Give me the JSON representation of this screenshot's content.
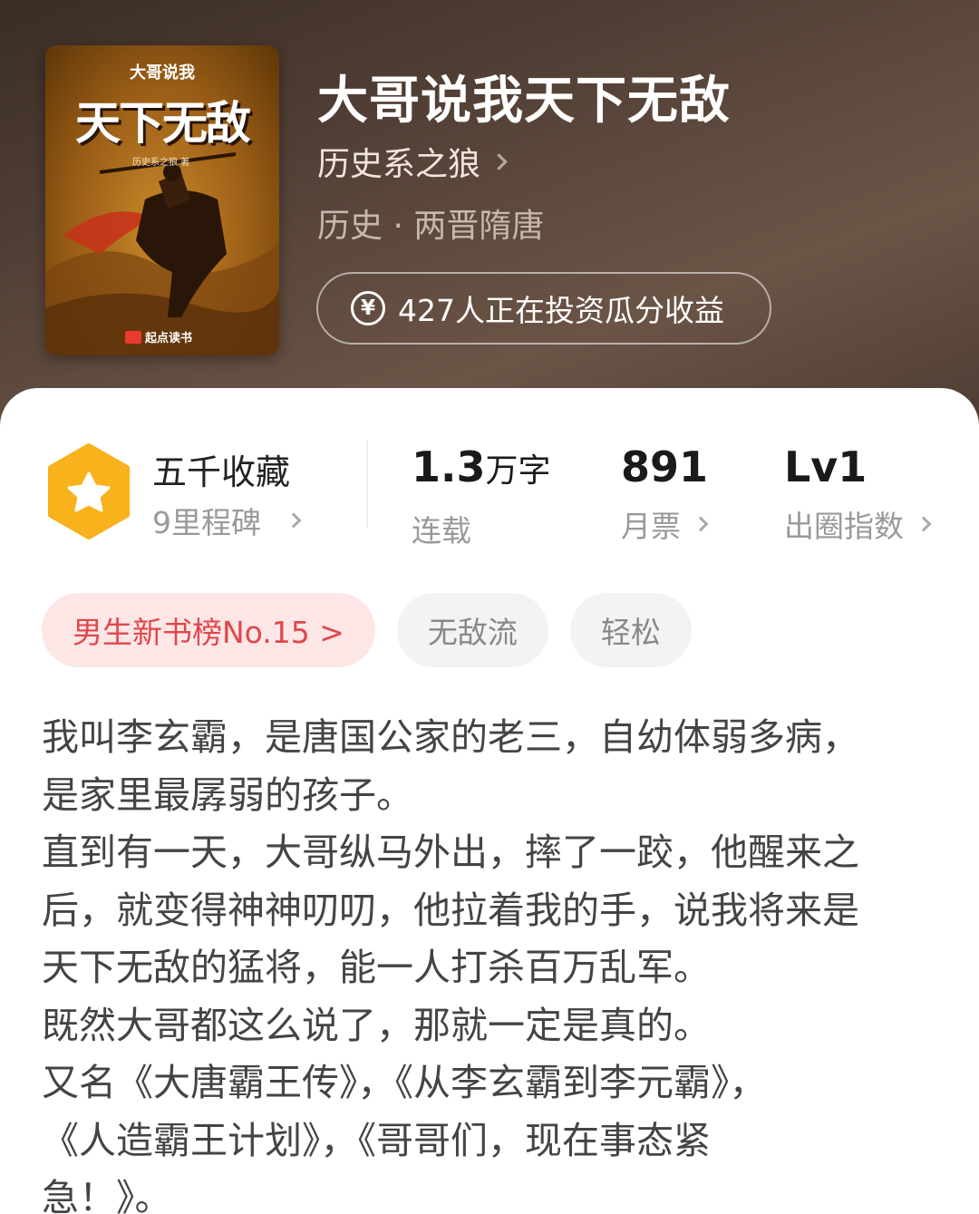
{
  "book": {
    "title": "大哥说我天下无敌",
    "author": "历史系之狼",
    "genre": "历史 · 两晋隋唐",
    "invest_text": "427人正在投资瓜分收益"
  },
  "cover": {
    "subtitle": "大哥说我",
    "title": "天下无敌",
    "author": "历史系之狼 著",
    "publisher": "起点读书"
  },
  "stats": {
    "favorites_title": "五千收藏",
    "milestone": "9里程碑",
    "word_count": "1.3",
    "word_unit": "万字",
    "status": "连载",
    "monthly_votes": "891",
    "monthly_votes_label": "月票",
    "level": "Lv1",
    "level_label": "出圈指数"
  },
  "tags": [
    "男生新书榜No.15 >",
    "无敌流",
    "轻松"
  ],
  "description": "我叫李玄霸，是唐国公家的老三，自幼体弱多病，\n是家里最孱弱的孩子。\n直到有一天，大哥纵马外出，摔了一跤，他醒来之\n后，就变得神神叨叨，他拉着我的手，说我将来是\n天下无敌的猛将，能一人打杀百万乱军。\n既然大哥都这么说了，那就一定是真的。\n又名《大唐霸王传》，《从李玄霸到李元霸》，\n《人造霸王计划》，《哥哥们，现在事态紧\n急！》。",
  "colors": {
    "header_bg": "#4a3a32",
    "badge": "#f7b21c",
    "rank_tag_bg": "#fde6e6",
    "rank_tag_text": "#e0474a"
  }
}
